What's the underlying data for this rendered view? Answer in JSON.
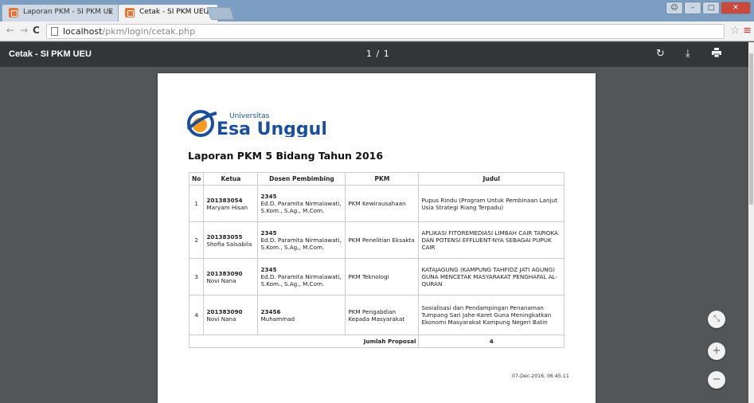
{
  "browser": {
    "tabs": [
      {
        "label": "Laporan PKM - SI PKM UE"
      },
      {
        "label": "Cetak - SI PKM UEU"
      }
    ],
    "url_host": "localhost",
    "url_path": "/pkm/login/cetak.php"
  },
  "pdf_viewer": {
    "title": "Cetak - SI PKM UEU",
    "page_indicator": "1 / 1"
  },
  "document": {
    "logo_small": "Universitas",
    "logo_big": "Esa Unggul",
    "title": "Laporan PKM 5 Bidang Tahun 2016",
    "columns": [
      "No",
      "Ketua",
      "Dosen Pembimbing",
      "PKM",
      "Judul"
    ],
    "rows": [
      {
        "no": "1",
        "ketua_id": "201383054",
        "ketua_name": "Maryam Hisan",
        "dosen_id": "2345",
        "dosen_name": "Ed.D. Paramita Nirmalawati, S.Kom., S.Ag., M.Com.",
        "pkm": "PKM Kewirausahaan",
        "judul": "Pupus Rindu (Program Untuk Pembinaan Lanjut Usia Strategi Riang Terpadu)"
      },
      {
        "no": "2",
        "ketua_id": "201383055",
        "ketua_name": "Shofia Salsabila",
        "dosen_id": "2345",
        "dosen_name": "Ed.D. Paramita Nirmalawati, S.Kom., S.Ag., M.Com.",
        "pkm": "PKM Penelitian Eksakta",
        "judul": "APLIKASI FITOREMEDIASI LIMBAH CAIR TAPIOKA DAN POTENSI EFFLUENT-NYA SEBAGAI PUPUK CAIR"
      },
      {
        "no": "3",
        "ketua_id": "201383090",
        "ketua_name": "Novi Nana",
        "dosen_id": "2345",
        "dosen_name": "Ed.D. Paramita Nirmalawati, S.Kom., S.Ag., M.Com.",
        "pkm": "PKM Teknologi",
        "judul": "KATAJAGUNG (KAMPUNG TAHFIDZ JATI AGUNG) GUNA MENCETAK MASYARAKAT PENGHAFAL AL- QURAN"
      },
      {
        "no": "4",
        "ketua_id": "201383090",
        "ketua_name": "Novi Nana",
        "dosen_id": "23456",
        "dosen_name": "Muhammad",
        "pkm": "PKM Pengabdian Kepada Masyarakat",
        "judul": "Sosialisasi dan Pendampingan Penanaman Tumpang Sari Jahe-Karet Guna Meningkatkan Ekonomi Masyarakat Kampung Negeri Batin"
      }
    ],
    "total_label": "Jumlah Proposal",
    "total_value": "4",
    "timestamp": "07-Dec-2016, 06:45:11"
  },
  "colors": {
    "viewer_bg": "#525659",
    "toolbar_bg": "#323639",
    "logo_blue": "#1b4f9c",
    "logo_orange": "#f39a1f"
  },
  "icons": [
    "rotate-icon",
    "download-icon",
    "print-icon",
    "fit-page-icon",
    "zoom-in-icon",
    "zoom-out-icon"
  ]
}
